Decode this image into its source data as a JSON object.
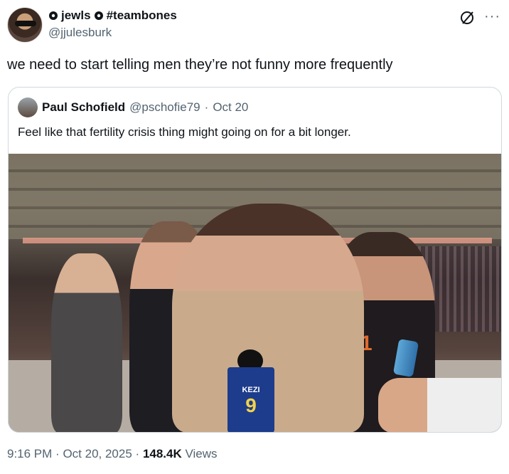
{
  "author": {
    "display_name": "jewls",
    "hashtag": "#teambones",
    "handle": "@jjulesburk"
  },
  "tweet_text": "we need to start telling men they’re not funny more frequently",
  "quote": {
    "author_name": "Paul Schofield",
    "handle": "@pschofie79",
    "separator": "·",
    "date": "Oct 20",
    "text": "Feel like that fertility crisis thing might going on for a bit longer.",
    "media": {
      "mic_logo": "KEZI",
      "mic_number": "9",
      "jersey_number": "1"
    }
  },
  "footer": {
    "time": "9:16 PM",
    "separator": "·",
    "date": "Oct 20, 2025",
    "views_count": "148.4K",
    "views_label": "Views"
  },
  "icons": {
    "badge": "flower-badge-icon",
    "grok": "grok-icon",
    "more": "more-icon"
  }
}
